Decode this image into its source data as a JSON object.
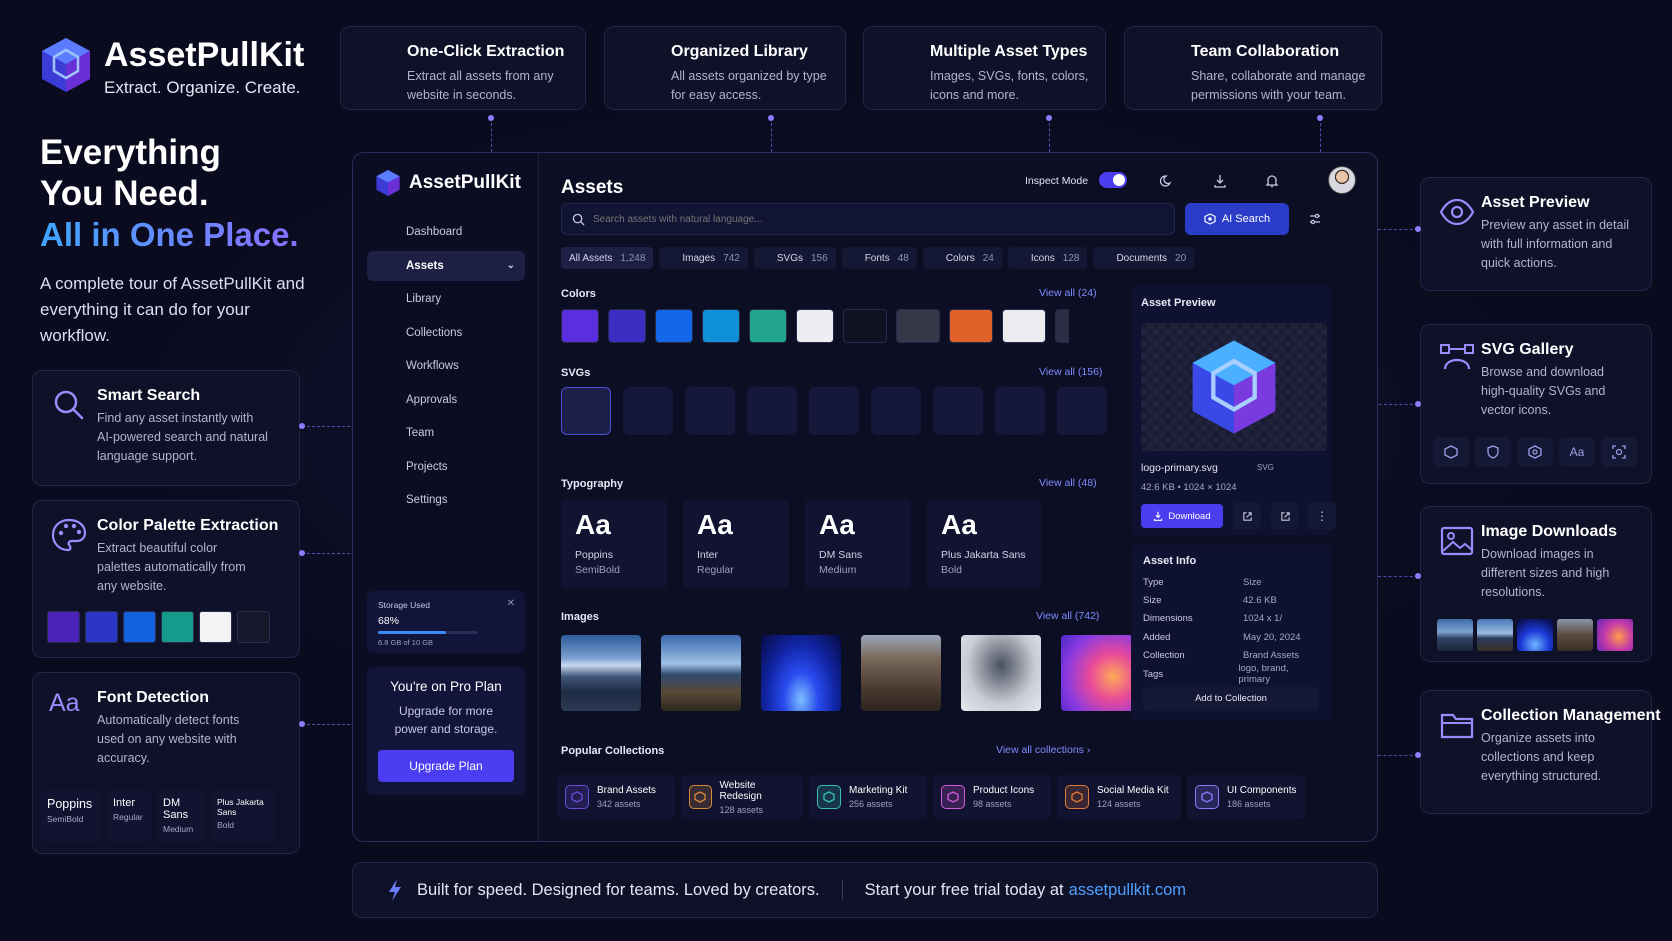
{
  "brand": {
    "name": "AssetPullKit",
    "tagline": "Extract. Organize. Create."
  },
  "hero": {
    "line1": "Everything",
    "line2": "You Need.",
    "line3": "All in One Place.",
    "desc": "A complete tour of AssetPullKit and everything it can do for your workflow."
  },
  "top_features": [
    {
      "title": "One-Click Extraction",
      "desc": "Extract all assets from any website in seconds.",
      "icon": "globe-icon"
    },
    {
      "title": "Organized Library",
      "desc": "All assets organized by type for easy access.",
      "icon": "folder-icon"
    },
    {
      "title": "Multiple Asset Types",
      "desc": "Images, SVGs, fonts, colors, icons and more.",
      "icon": "layers-icon"
    },
    {
      "title": "Team Collaboration",
      "desc": "Share, collaborate and manage permissions with your team.",
      "icon": "users-icon"
    }
  ],
  "left_features": [
    {
      "title": "Smart Search",
      "desc": "Find any asset instantly with AI-powered search and natural language support.",
      "icon": "search-icon"
    },
    {
      "title": "Color Palette Extraction",
      "desc": "Extract beautiful color palettes automatically from any website.",
      "icon": "palette-icon",
      "swatches": [
        "#4a22b8",
        "#2c36c6",
        "#1461e0",
        "#159a8c",
        "#f3f3f6",
        "#15182a"
      ]
    },
    {
      "title": "Font Detection",
      "desc": "Automatically detect fonts used on any website with accuracy.",
      "icon": "font-icon",
      "fonts": [
        {
          "name": "Poppins",
          "weight": "SemiBold"
        },
        {
          "name": "Inter",
          "weight": "Regular"
        },
        {
          "name": "DM Sans",
          "weight": "Medium"
        },
        {
          "name": "Plus Jakarta Sans",
          "weight": "Bold"
        }
      ]
    }
  ],
  "right_features": [
    {
      "title": "Asset Preview",
      "desc": "Preview any asset in detail with full information and quick actions.",
      "icon": "eye-icon"
    },
    {
      "title": "SVG Gallery",
      "desc": "Browse and download high-quality SVGs and vector icons.",
      "icon": "vector-icon"
    },
    {
      "title": "Image Downloads",
      "desc": "Download images in different sizes and high resolutions.",
      "icon": "image-icon"
    },
    {
      "title": "Collection Management",
      "desc": "Organize assets into collections and keep everything structured.",
      "icon": "folder-icon"
    }
  ],
  "app": {
    "logo": "AssetPullKit",
    "page_title": "Assets",
    "inspect_mode": "Inspect Mode",
    "search_placeholder": "Search assets with natural language...",
    "ai_search": "AI Search",
    "nav": [
      {
        "label": "Dashboard",
        "icon": "home-icon"
      },
      {
        "label": "Assets",
        "icon": "assets-icon",
        "active": true
      },
      {
        "label": "Library",
        "icon": "library-icon"
      },
      {
        "label": "Collections",
        "icon": "collections-icon"
      },
      {
        "label": "Workflows",
        "icon": "workflow-icon"
      },
      {
        "label": "Approvals",
        "icon": "approval-icon"
      },
      {
        "label": "Team",
        "icon": "team-icon"
      },
      {
        "label": "Projects",
        "icon": "projects-icon"
      },
      {
        "label": "Settings",
        "icon": "gear-icon"
      }
    ],
    "storage": {
      "label": "Storage Used",
      "percent": "68%",
      "fraction": 0.68,
      "detail": "6.8 GB of 10 GB"
    },
    "plan": {
      "title": "You're on Pro Plan",
      "desc": "Upgrade for more power and storage.",
      "button": "Upgrade Plan"
    },
    "filters": [
      {
        "label": "All Assets",
        "count": "1,248"
      },
      {
        "label": "Images",
        "count": "742"
      },
      {
        "label": "SVGs",
        "count": "156"
      },
      {
        "label": "Fonts",
        "count": "48"
      },
      {
        "label": "Colors",
        "count": "24"
      },
      {
        "label": "Icons",
        "count": "128"
      },
      {
        "label": "Documents",
        "count": "20"
      }
    ],
    "colors": {
      "title": "Colors",
      "view_all": "View all (24)",
      "swatches": [
        "#5b2ee0",
        "#3a2fc2",
        "#1466ea",
        "#0f8fd6",
        "#22a58e",
        "#eeeef2",
        "#101224",
        "#36384a",
        "#e2602a",
        "#ececf0",
        "#2a2d44"
      ]
    },
    "svgs": {
      "title": "SVGs",
      "view_all": "View all (156)",
      "icons": [
        "cube-icon",
        "shield-icon",
        "layers-icon",
        "cloud-upload-icon",
        "pie-chart-icon",
        "user-icon",
        "gear-icon",
        "folder-icon",
        "star-icon"
      ]
    },
    "typography": {
      "title": "Typography",
      "view_all": "View all (48)",
      "fonts": [
        {
          "aa": "Aa",
          "name": "Poppins",
          "weight": "SemiBold"
        },
        {
          "aa": "Aa",
          "name": "Inter",
          "weight": "Regular"
        },
        {
          "aa": "Aa",
          "name": "DM Sans",
          "weight": "Medium"
        },
        {
          "aa": "Aa",
          "name": "Plus Jakarta Sans",
          "weight": "Bold"
        }
      ]
    },
    "images": {
      "title": "Images",
      "view_all": "View all (742)"
    },
    "collections": {
      "title": "Popular Collections",
      "view_all": "View all collections",
      "items": [
        {
          "name": "Brand Assets",
          "count": "342 assets",
          "color": "#6b4bd8"
        },
        {
          "name": "Website Redesign",
          "count": "128 assets",
          "color": "#d88a3a"
        },
        {
          "name": "Marketing Kit",
          "count": "256 assets",
          "color": "#36c3b5"
        },
        {
          "name": "Product Icons",
          "count": "98 assets",
          "color": "#d45ad6"
        },
        {
          "name": "Social Media Kit",
          "count": "124 assets",
          "color": "#e07a3a"
        },
        {
          "name": "UI Components",
          "count": "186 assets",
          "color": "#8a7cff"
        }
      ]
    },
    "preview": {
      "title": "Asset Preview",
      "file": "logo-primary.svg",
      "badge": "SVG",
      "size": "42.6 KB",
      "dims": "1024 × 1024",
      "download": "Download"
    },
    "info": {
      "title": "Asset Info",
      "rows": [
        {
          "k": "Type",
          "v": "Size"
        },
        {
          "k": "Size",
          "v": "42.6 KB"
        },
        {
          "k": "Dimensions",
          "v": "1024 x 1/"
        },
        {
          "k": "Added",
          "v": "May 20, 2024"
        },
        {
          "k": "Collection",
          "v": "Brand Assets"
        },
        {
          "k": "Tags",
          "v": "logo, brand, primary"
        }
      ],
      "button": "Add to Collection"
    }
  },
  "footer": {
    "left": "Built for speed. Designed for teams. Loved by creators.",
    "mid": "Start your free trial today at",
    "link": "assetpullkit.com"
  },
  "accent": "#5b5cf6"
}
